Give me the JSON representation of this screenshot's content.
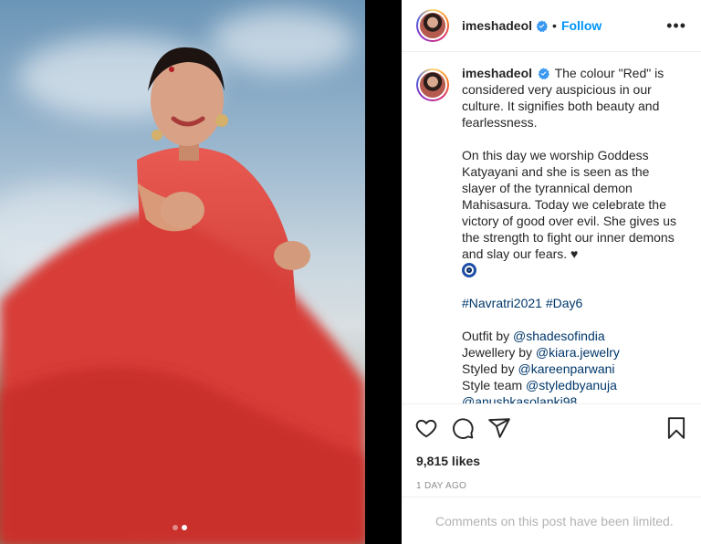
{
  "post": {
    "username": "imeshadeol",
    "follow_label": "Follow",
    "separator": "•",
    "more_label": "•••",
    "caption": {
      "intro": "The colour \"Red\" is considered very auspicious in our culture. It signifies both beauty and fearlessness.",
      "paragraph2": "On this day we worship Goddess Katyayani and she is seen as the slayer of the tyrannical demon Mahisasura. Today we celebrate the victory of good over evil. She gives us the strength to fight our inner demons and slay our fears. ♥",
      "hashtags": [
        "#Navratri2021",
        "#Day6"
      ],
      "credits": [
        {
          "label": "Outfit by ",
          "handle": "@shadesofindia"
        },
        {
          "label": "Jewellery by ",
          "handle": "@kiara.jewelry"
        },
        {
          "label": "Styled by ",
          "handle": "@kareenparwani"
        },
        {
          "label": "Style team ",
          "handle": "@styledbyanuja"
        }
      ],
      "extra_handle": "@anushkasolanki98"
    },
    "likes": "9,815 likes",
    "timestamp": "1 DAY AGO",
    "comments_notice": "Comments on this post have been limited.",
    "carousel": {
      "total": 2,
      "current": 2
    }
  },
  "icons": [
    "verified-badge-icon",
    "heart-icon",
    "comment-icon",
    "share-icon",
    "bookmark-icon",
    "more-options-icon",
    "evil-eye-emoji-icon"
  ],
  "colors": {
    "accent": "#0095f6",
    "link": "#00376b",
    "muted": "#8e8e8e",
    "dress": "#e0433f"
  }
}
